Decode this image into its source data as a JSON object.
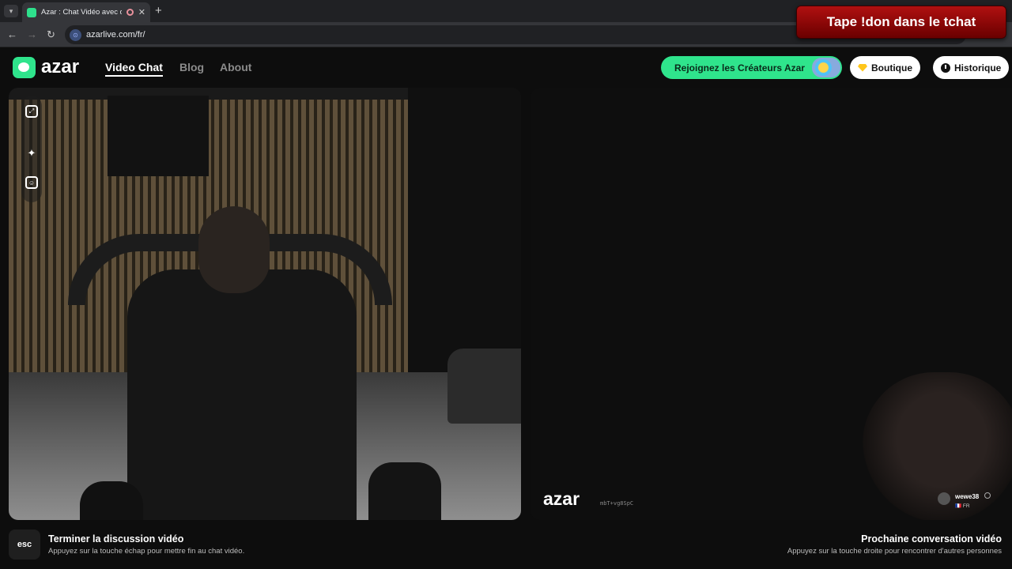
{
  "browser": {
    "tab_title": "Azar : Chat Vidéo avec de n",
    "url": "azarlive.com/fr/",
    "icons": [
      "tab-list-icon",
      "close-icon",
      "new-tab-icon",
      "back-icon",
      "forward-icon",
      "reload-icon",
      "site-info-icon"
    ],
    "stream_overlay": "Tape !don dans le tchat"
  },
  "header": {
    "logo": "azar",
    "nav": [
      "Video Chat",
      "Blog",
      "About"
    ],
    "active_nav": "Video Chat",
    "creators_button": "Rejoignez les Créateurs Azar",
    "shop_button": "Boutique",
    "history_button": "Historique",
    "accent_color": "#2fe48c"
  },
  "left_video": {
    "tools": [
      "expand-icon",
      "sparkle-effects-icon",
      "face-sticker-icon"
    ]
  },
  "right_video": {
    "watermark": "azar",
    "watermark_id": "mbT+vg8SpC",
    "user_name": "wewe38",
    "user_country": "FR"
  },
  "footer": {
    "esc_key": "esc",
    "end_title": "Terminer la discussion vidéo",
    "end_desc": "Appuyez sur la touche échap pour mettre fin au chat vidéo.",
    "next_title": "Prochaine conversation vidéo",
    "next_desc": "Appuyez sur la touche droite pour rencontrer d'autres personnes"
  }
}
